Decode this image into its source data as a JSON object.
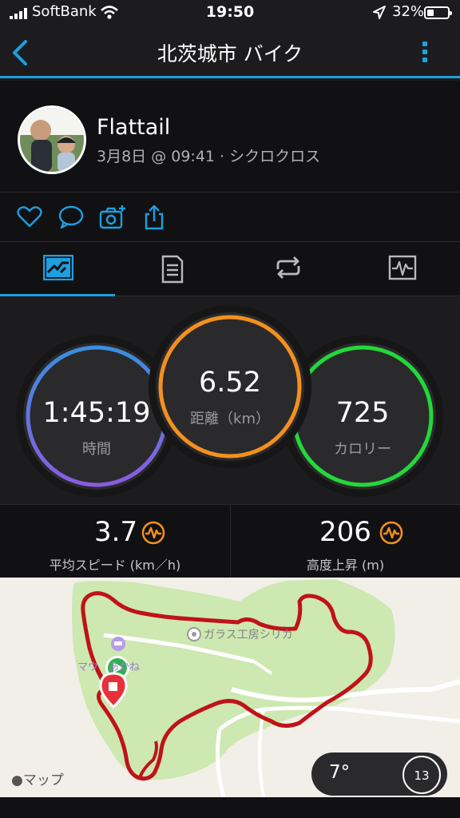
{
  "status_bar": {
    "carrier": "SoftBank",
    "time": "19:50",
    "battery": "32%",
    "battery_level": 0.32
  },
  "nav": {
    "title": "北茨城市 バイク"
  },
  "profile": {
    "name": "Flattail",
    "subline": "3月8日 @ 09:41 · シクロクロス"
  },
  "actions": [
    "like-icon",
    "comment-icon",
    "add-photo-icon",
    "share-icon"
  ],
  "tabs": [
    "overview-tab",
    "details-tab",
    "laps-tab",
    "charts-tab"
  ],
  "summary": {
    "time": {
      "value": "1:45:19",
      "label": "時間"
    },
    "distance": {
      "value": "6.52",
      "label": "距離（km）"
    },
    "calories": {
      "value": "725",
      "label": "カロリー"
    }
  },
  "stats": {
    "avg_speed": {
      "value": "3.7",
      "label": "平均スピード (km／h)"
    },
    "elevation_gain": {
      "value": "206",
      "label": "高度上昇 (m)"
    }
  },
  "map": {
    "poi_glass": "ガラス工房シリカ",
    "poi_hotel": "マウ　あかね",
    "provider": "マップ",
    "temperature": "7°",
    "aqi": "13"
  },
  "colors": {
    "accent": "#1d9fe0",
    "time_ring": [
      "#3a8fe0",
      "#8a5be0"
    ],
    "distance_ring": "#f4901e",
    "calories_ring": "#22d83a",
    "track": "#c0121a"
  }
}
